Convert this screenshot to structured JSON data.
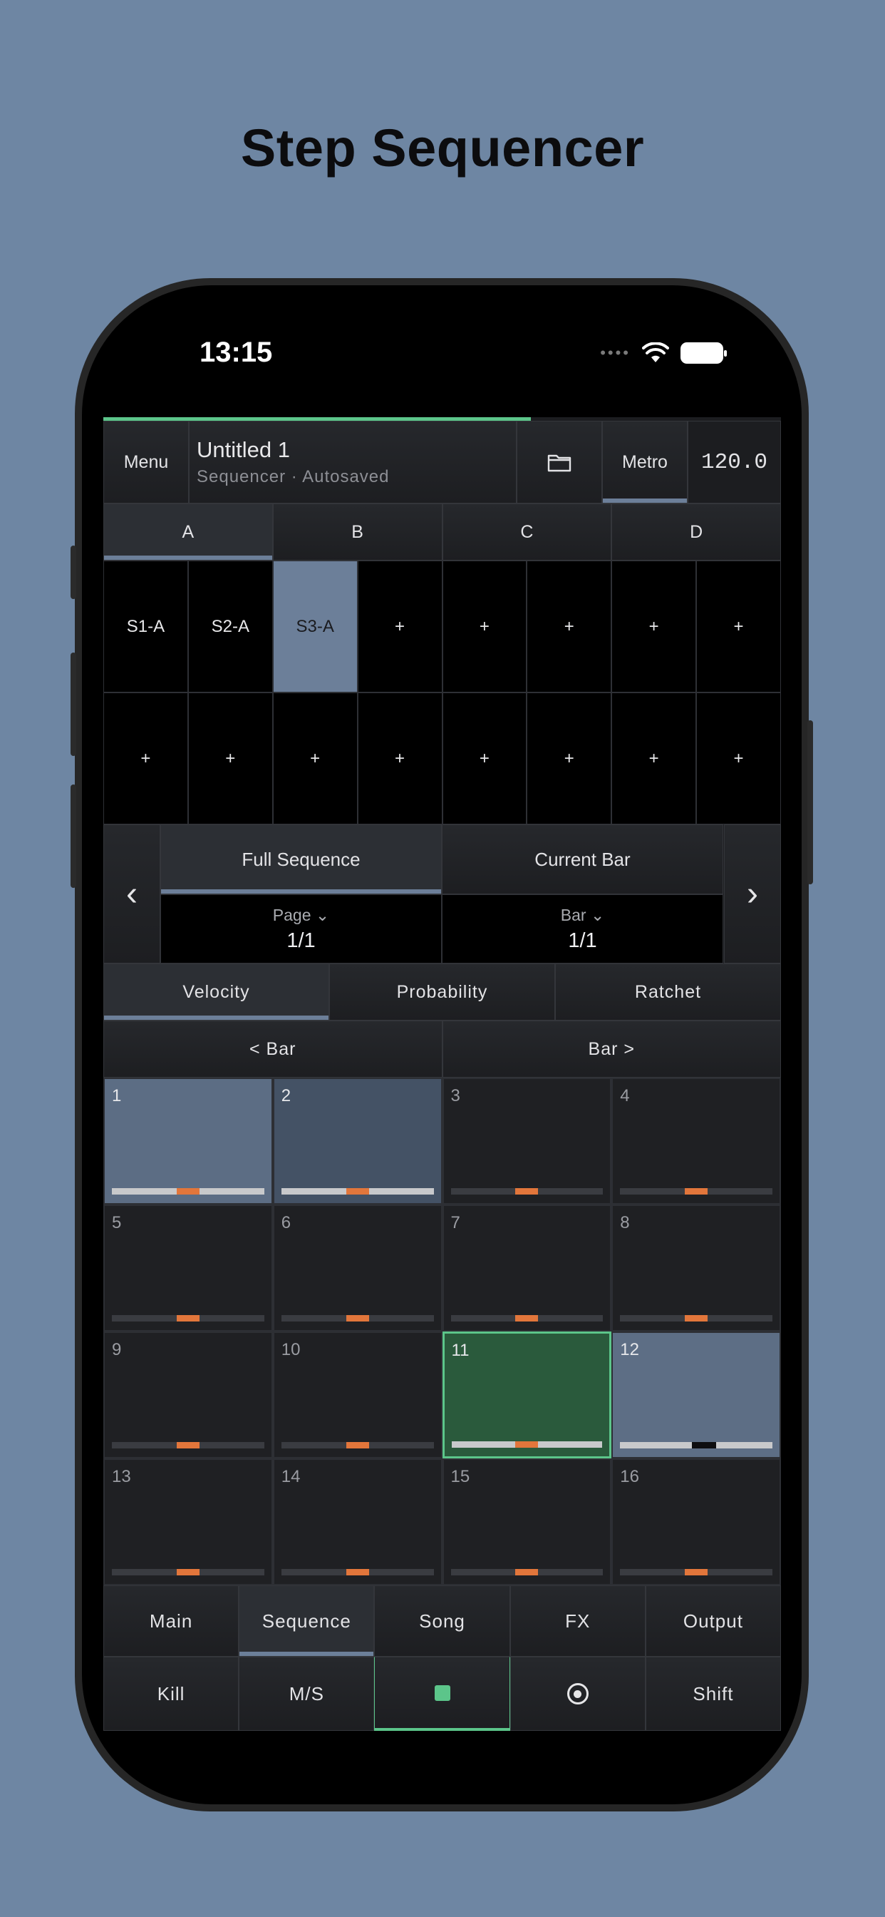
{
  "headline": "Step Sequencer",
  "status": {
    "time": "13:15"
  },
  "topbar": {
    "menu": "Menu",
    "title": "Untitled 1",
    "subtitle": "Sequencer · Autosaved",
    "metro": "Metro",
    "tempo": "120.0"
  },
  "pattern_tabs": [
    "A",
    "B",
    "C",
    "D"
  ],
  "slots": [
    "S1-A",
    "S2-A",
    "S3-A",
    "+",
    "+",
    "+",
    "+",
    "+",
    "+",
    "+",
    "+",
    "+",
    "+",
    "+",
    "+",
    "+"
  ],
  "scope": {
    "full": "Full Sequence",
    "current": "Current Bar",
    "page_label": "Page",
    "page_value": "1/1",
    "bar_label": "Bar",
    "bar_value": "1/1",
    "prev": "‹",
    "next": "›"
  },
  "params": [
    "Velocity",
    "Probability",
    "Ratchet"
  ],
  "barnav": {
    "prev": "< Bar",
    "next": "Bar >"
  },
  "steps": [
    "1",
    "2",
    "3",
    "4",
    "5",
    "6",
    "7",
    "8",
    "9",
    "10",
    "11",
    "12",
    "13",
    "14",
    "15",
    "16"
  ],
  "nav": [
    "Main",
    "Sequence",
    "Song",
    "FX",
    "Output"
  ],
  "tools": {
    "kill": "Kill",
    "ms": "M/S",
    "shift": "Shift"
  },
  "colors": {
    "accent_green": "#5cc58a",
    "accent_blue": "#6c7f99",
    "marker_orange": "#e2763b",
    "background": "#6e86a3"
  }
}
